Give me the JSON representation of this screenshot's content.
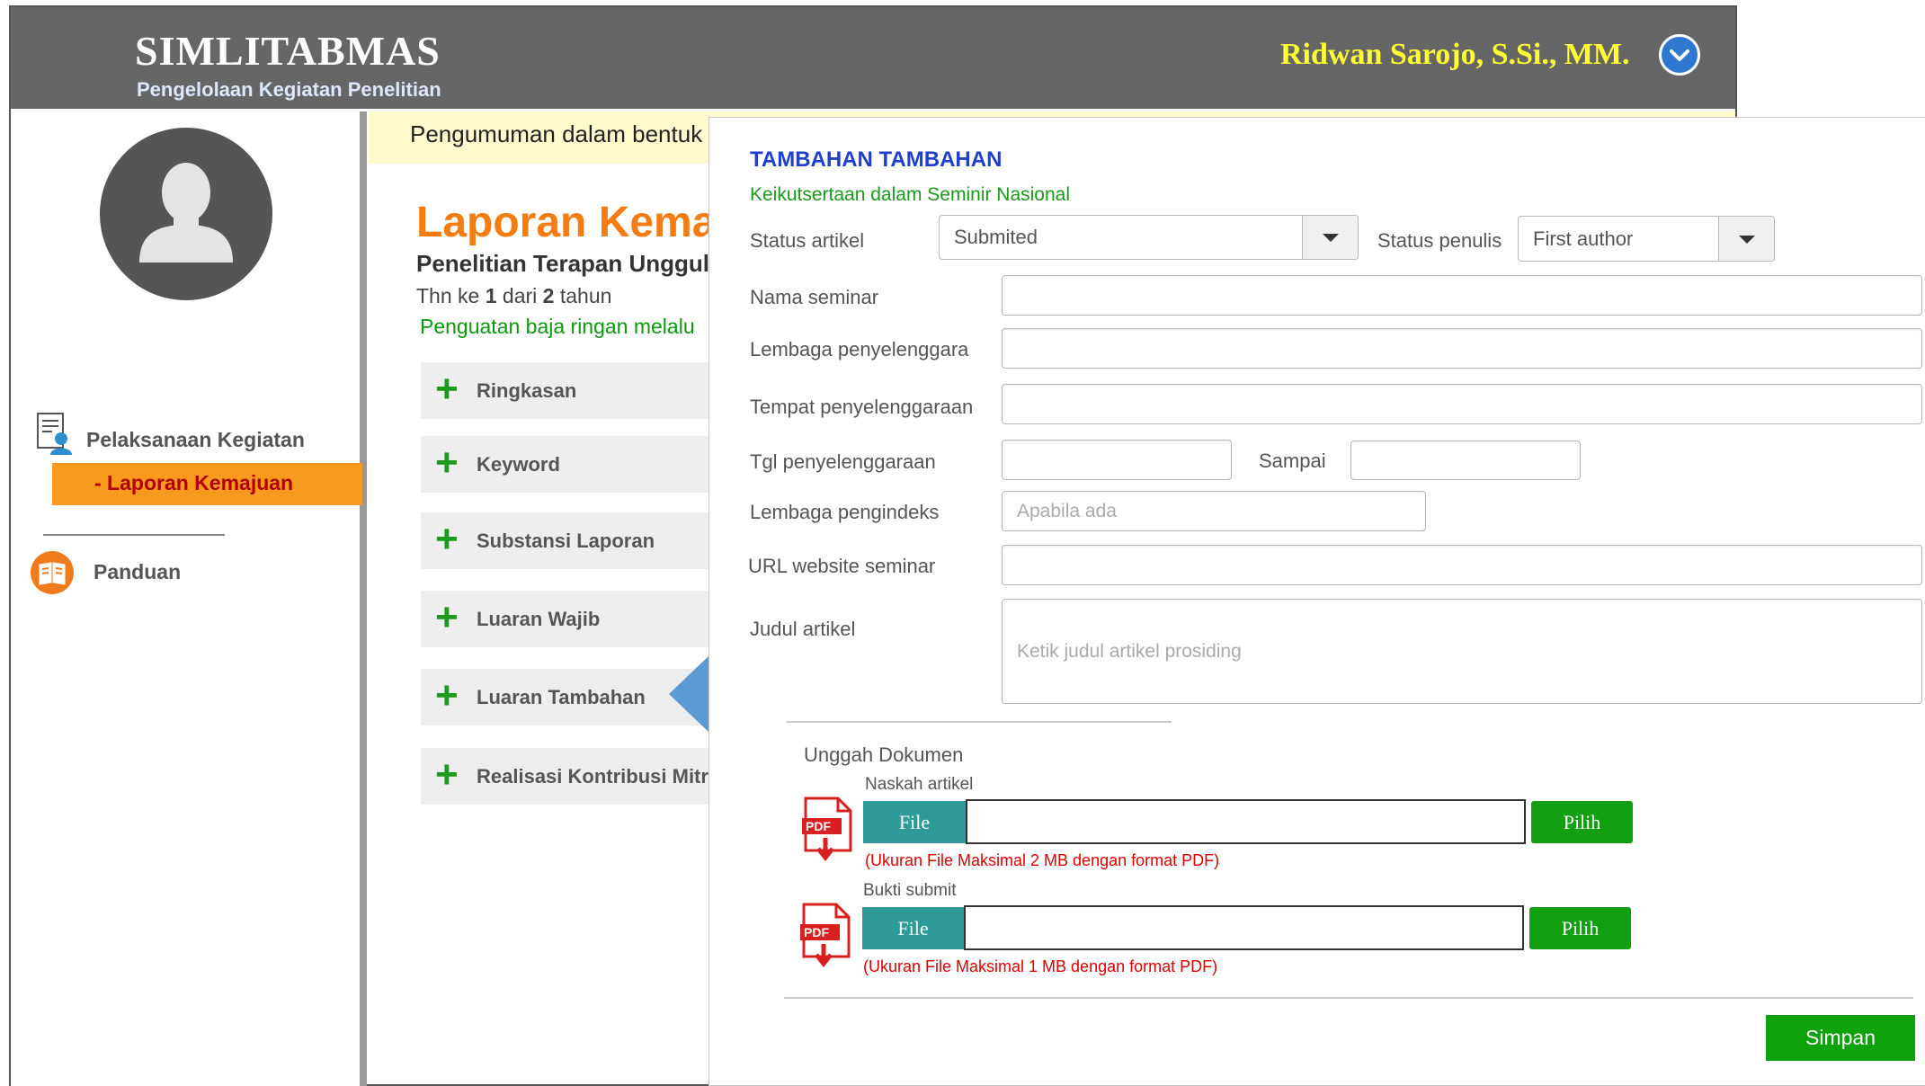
{
  "header": {
    "app_title": "SIMLITABMAS",
    "app_subtitle": "Pengelolaan Kegiatan Penelitian",
    "user_name": "Ridwan Sarojo, S.Si., MM."
  },
  "sidebar": {
    "menu_kegiatan": "Pelaksanaan Kegiatan",
    "menu_laporan": "- Laporan Kemajuan",
    "menu_panduan": "Panduan"
  },
  "main": {
    "announcement": "Pengumuman dalam bentuk",
    "title": "Laporan Kemaj",
    "subtitle": "Penelitian Terapan Unggul",
    "year_prefix": "Thn ke ",
    "year_current": "1",
    "year_mid": " dari ",
    "year_total": "2",
    "year_suffix": " tahun",
    "research_title": "Penguatan baja ringan melalu",
    "accordion": [
      "Ringkasan",
      "Keyword",
      "Substansi Laporan",
      "Luaran Wajib",
      "Luaran Tambahan",
      "Realisasi Kontribusi Mitr"
    ]
  },
  "dialog": {
    "title": "TAMBAHAN TAMBAHAN",
    "subtitle": "Keikutsertaan dalam Seminir Nasional",
    "status_artikel_label": "Status artikel",
    "status_artikel_value": "Submited",
    "status_penulis_label": "Status penulis",
    "status_penulis_value": "First author",
    "nama_seminar_label": "Nama seminar",
    "lembaga_penyelenggara_label": "Lembaga penyelenggara",
    "tempat_penyelenggaraan_label": "Tempat penyelenggaraan",
    "tgl_penyelenggaraan_label": "Tgl penyelenggaraan",
    "sampai_label": "Sampai",
    "lembaga_pengindeks_label": "Lembaga pengindeks",
    "lembaga_pengindeks_placeholder": "Apabila ada",
    "url_label": "URL website seminar",
    "judul_label": "Judul artikel",
    "judul_placeholder": "Ketik judul artikel prosiding",
    "upload_heading": "Unggah Dokumen",
    "naskah_label": "Naskah artikel",
    "naskah_note": "(Ukuran File Maksimal 2 MB dengan format PDF)",
    "bukti_label": "Bukti submit",
    "bukti_note": "(Ukuran File Maksimal 1 MB dengan format PDF)",
    "file_button": "File",
    "pick_button": "Pilih",
    "pdf_icon_text": "PDF",
    "save_button": "Simpan"
  },
  "colors": {
    "topbar": "#666666",
    "accent_orange": "#f57c10",
    "green_button": "#12a012",
    "teal_button": "#2e9a9a",
    "dialog_title": "#1f3fcc",
    "error_red": "#e00000"
  }
}
